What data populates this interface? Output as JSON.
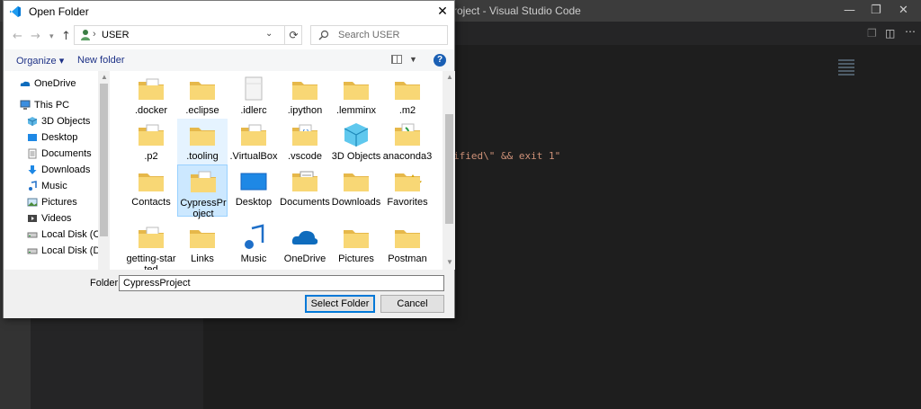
{
  "vscode": {
    "title": "roject - Visual Studio Code",
    "code_line": "ified\\\" && exit 1\""
  },
  "dialog": {
    "title": "Open Folder",
    "close_label": "✕"
  },
  "address_bar": {
    "path": "USER",
    "separator": "›"
  },
  "search": {
    "placeholder": "Search USER"
  },
  "command_bar": {
    "organize": "Organize ▾",
    "new_folder": "New folder",
    "help": "?"
  },
  "nav_pane": {
    "items": [
      {
        "label": "OneDrive",
        "icon": "onedrive-icon"
      },
      {
        "label": "This PC",
        "icon": "computer-icon"
      },
      {
        "label": "3D Objects",
        "icon": "3d-objects-icon"
      },
      {
        "label": "Desktop",
        "icon": "desktop-icon"
      },
      {
        "label": "Documents",
        "icon": "documents-icon"
      },
      {
        "label": "Downloads",
        "icon": "downloads-icon"
      },
      {
        "label": "Music",
        "icon": "music-icon"
      },
      {
        "label": "Pictures",
        "icon": "pictures-icon"
      },
      {
        "label": "Videos",
        "icon": "videos-icon"
      },
      {
        "label": "Local Disk (C:)",
        "icon": "drive-icon"
      },
      {
        "label": "Local Disk (D:)",
        "icon": "drive-icon"
      }
    ]
  },
  "files": [
    {
      "label": ".docker",
      "type": "folder-doc"
    },
    {
      "label": ".eclipse",
      "type": "folder"
    },
    {
      "label": ".idlerc",
      "type": "folder-white"
    },
    {
      "label": ".ipython",
      "type": "folder"
    },
    {
      "label": ".lemminx",
      "type": "folder"
    },
    {
      "label": ".m2",
      "type": "folder"
    },
    {
      "label": ".p2",
      "type": "folder-doc"
    },
    {
      "label": ".tooling",
      "type": "folder"
    },
    {
      "label": ".VirtualBox",
      "type": "folder-doc"
    },
    {
      "label": ".vscode",
      "type": "folder-code"
    },
    {
      "label": "3D Objects",
      "type": "folder-3d"
    },
    {
      "label": "anaconda3",
      "type": "folder-green"
    },
    {
      "label": "Contacts",
      "type": "folder-contacts"
    },
    {
      "label": "CypressProject",
      "type": "folder-doc"
    },
    {
      "label": "Desktop",
      "type": "folder-desktop"
    },
    {
      "label": "Documents",
      "type": "folder-documents"
    },
    {
      "label": "Downloads",
      "type": "folder-downloads"
    },
    {
      "label": "Favorites",
      "type": "folder-star"
    },
    {
      "label": "getting-started",
      "type": "folder-doc"
    },
    {
      "label": "Links",
      "type": "folder-links"
    },
    {
      "label": "Music",
      "type": "folder-music"
    },
    {
      "label": "OneDrive",
      "type": "folder-onedrive"
    },
    {
      "label": "Pictures",
      "type": "folder-pictures"
    },
    {
      "label": "Postman",
      "type": "folder"
    }
  ],
  "bottom": {
    "folder_label": "Folder:",
    "folder_value": "CypressProject",
    "select_button": "Select Folder",
    "cancel_button": "Cancel"
  },
  "colors": {
    "folder": "#f8d775",
    "folder_dark": "#e6b84a",
    "accent": "#0078d7"
  }
}
